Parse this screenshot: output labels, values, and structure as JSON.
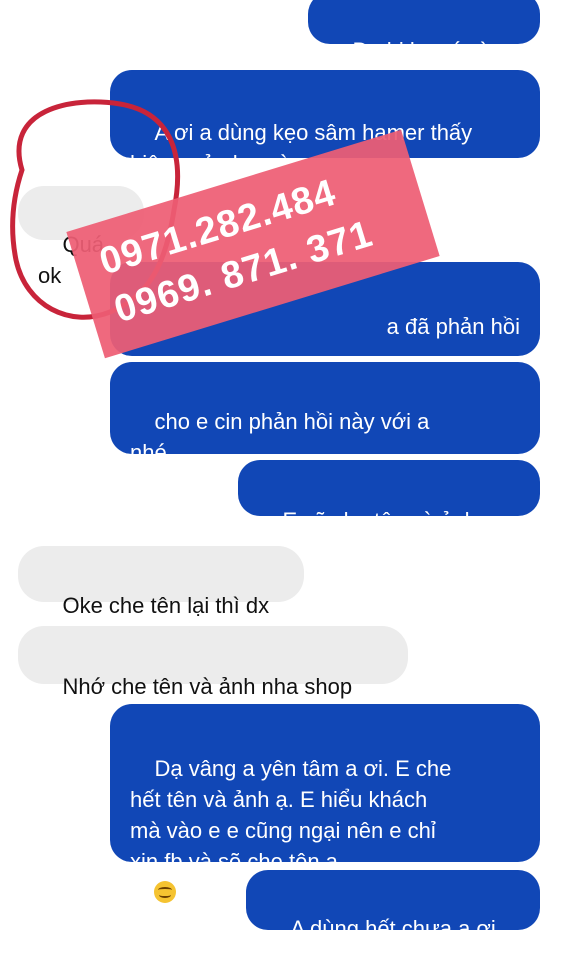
{
  "messages": [
    {
      "id": "m1",
      "side": "out",
      "text": "Dạ hi ko có gì ạ."
    },
    {
      "id": "m2",
      "side": "out",
      "text": "A ơi a dùng kẹo sâm hamer thấy\nhiệu quả như nào ạ"
    },
    {
      "id": "m3",
      "side": "in",
      "text": "Quá ok"
    },
    {
      "id": "m4",
      "side": "out",
      "text": "a đã phản hồi"
    },
    {
      "id": "m5",
      "side": "out",
      "text": "cho e cin phản hồi này với a\nnhé"
    },
    {
      "id": "m6",
      "side": "out",
      "text": "E sẽ che tên và ảnh ạ."
    },
    {
      "id": "m7",
      "side": "in",
      "text": "Oke che tên lại thì dx"
    },
    {
      "id": "m8",
      "side": "in",
      "text": "Nhớ che tên và ảnh nha shop"
    },
    {
      "id": "m9",
      "side": "out",
      "text": "Dạ vâng a yên tâm a ơi. E che\nhết tên và ảnh ạ. E hiểu khách\nmà vào e e cũng ngại nên e chỉ\nxin fb và sẽ che tên ạ.",
      "emoji": "smiling-face-icon"
    },
    {
      "id": "m10",
      "side": "out",
      "text": "A dùng hết chưa a ơi"
    }
  ],
  "watermark": {
    "phone_1": "0971.282.484",
    "phone_2": "0969. 871. 371",
    "color": "#ee5e74"
  },
  "colors": {
    "outgoing_bubble": "#1147b6",
    "incoming_bubble": "#ececec",
    "annotation_circle": "#c8243a"
  }
}
